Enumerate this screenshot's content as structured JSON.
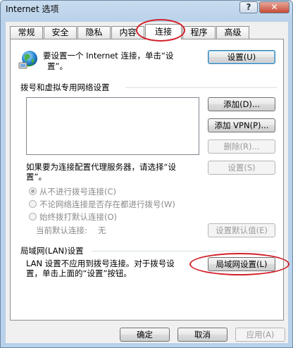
{
  "window": {
    "title": "Internet 选项",
    "help_label": "?",
    "close_label": "✕"
  },
  "tabs": [
    {
      "label": "常规"
    },
    {
      "label": "安全"
    },
    {
      "label": "隐私"
    },
    {
      "label": "内容"
    },
    {
      "label": "连接",
      "active": true
    },
    {
      "label": "程序"
    },
    {
      "label": "高级"
    }
  ],
  "setup": {
    "icon": "globe-connection-icon",
    "text_line1": "要设置一个 Internet 连接，单击“设",
    "text_line2": "置”。",
    "button_label": "设置(U)"
  },
  "dialup": {
    "group_label": "拨号和虚拟专用网络设置",
    "add_label": "添加(D)...",
    "add_vpn_label": "添加 VPN(P)...",
    "remove_label": "删除(R)...",
    "proxy_text_line1": "如果要为连接配置代理服务器，请选择“设",
    "proxy_text_line2": "置”。",
    "settings_label": "设置(S)",
    "options": [
      {
        "label": "从不进行拨号连接(C)",
        "checked": true
      },
      {
        "label": "不论网络连接是否存在都进行拨号(W)",
        "checked": false
      },
      {
        "label": "始终拨打默认连接(O)",
        "checked": false
      }
    ],
    "current_default_label": "当前默认连接:",
    "current_default_value": "无",
    "set_default_label": "设置默认值(E)"
  },
  "lan": {
    "group_label": "局域网(LAN)设置",
    "text_line1": "LAN 设置不应用到拨号连接。对于拨号设",
    "text_line2": "置，单击上面的“设置”按钮。",
    "button_label": "局域网设置(L)"
  },
  "footer": {
    "ok_label": "确定",
    "cancel_label": "取消",
    "apply_label": "应用(A)"
  },
  "colors": {
    "annotation_ring": "#d2202a",
    "title_bar": "#b9d1ea"
  }
}
